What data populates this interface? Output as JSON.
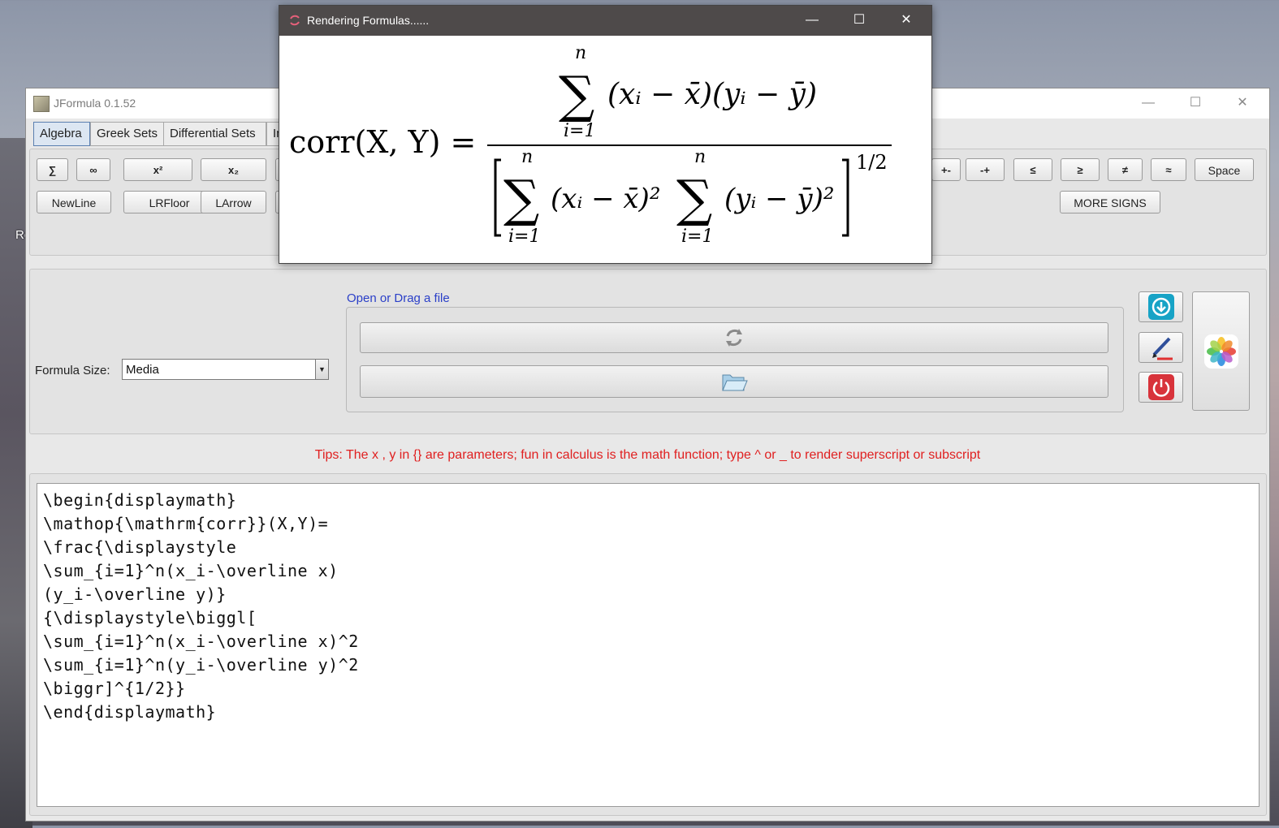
{
  "main_window": {
    "title": "JFormula 0.1.52",
    "controls": {
      "minimize": "—",
      "maximize": "☐",
      "close": "✕"
    }
  },
  "tabs": [
    "Algebra",
    "Greek Sets",
    "Differential Sets",
    "In"
  ],
  "toolbar": {
    "row1_left": [
      "∑",
      "∞",
      "x²",
      "x₂"
    ],
    "row2_left": [
      "NewLine",
      "LRFloor",
      "LArrow"
    ],
    "row1_right": [
      "+-",
      "-+",
      "≤",
      "≥",
      "≠",
      "≈",
      "Space"
    ],
    "more_signs": "MORE SIGNS"
  },
  "formula_size": {
    "label": "Formula Size:",
    "value": "Media"
  },
  "file": {
    "open_link": "Open or Drag a file"
  },
  "icons": {
    "refresh": "refresh-icon",
    "folder": "folder-open-icon",
    "download": "download-icon",
    "pen": "pen-icon",
    "power": "power-icon",
    "photos": "photos-icon"
  },
  "tips": "Tips: The x , y in {} are parameters; fun in calculus is the math function; type ^ or _ to render superscript or subscript",
  "editor": {
    "lines": [
      "\\begin{displaymath}",
      "\\mathop{\\mathrm{corr}}(X,Y)=",
      "\\frac{\\displaystyle",
      "\\sum_{i=1}^n(x_i-\\overline x)",
      "(y_i-\\overline y)}",
      "{\\displaystyle\\biggl[",
      "\\sum_{i=1}^n(x_i-\\overline x)^2",
      "\\sum_{i=1}^n(y_i-\\overline y)^2",
      "\\biggr]^{1/2}}",
      "\\end{displaymath}"
    ]
  },
  "popup": {
    "title": "Rendering Formulas......",
    "controls": {
      "minimize": "—",
      "maximize": "☐",
      "close": "✕"
    },
    "formula": {
      "lhs": "corr(X, Y) =",
      "sum_upper": "n",
      "sum_lower": "i=1",
      "numerator_terms": "(xᵢ − x̄)(yᵢ − ȳ)",
      "denominator_term_1": "(xᵢ − x̄)²",
      "denominator_term_2": "(yᵢ − ȳ)²",
      "exponent": "1/2"
    }
  },
  "desktop": {
    "glyph": "Re"
  }
}
